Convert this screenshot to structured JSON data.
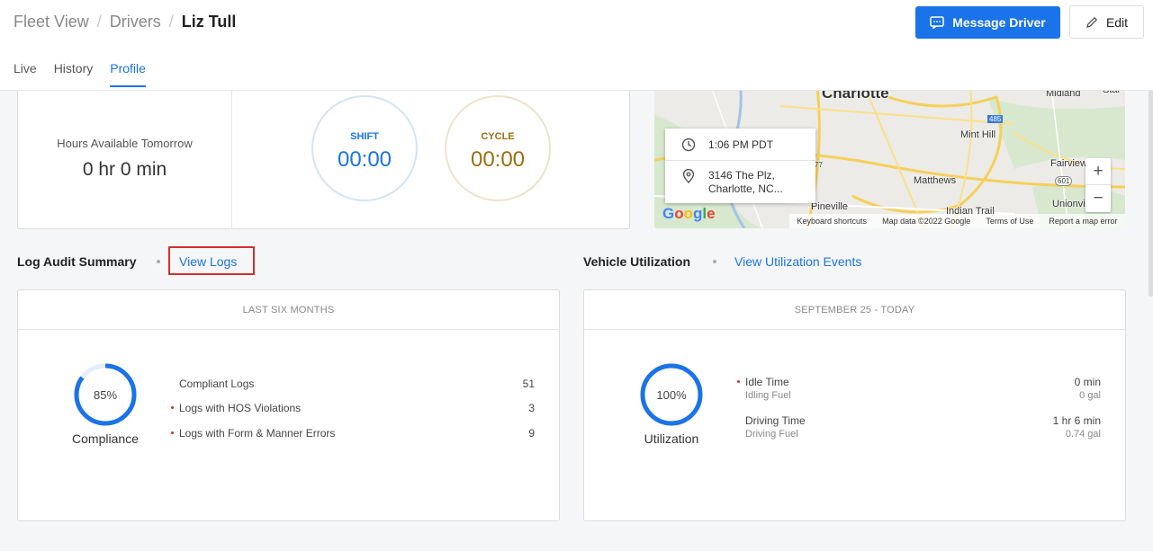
{
  "breadcrumb": {
    "items": [
      "Fleet View",
      "Drivers"
    ],
    "current": "Liz Tull"
  },
  "header": {
    "message_button": "Message Driver",
    "edit_button": "Edit"
  },
  "tabs": [
    {
      "label": "Live",
      "active": false
    },
    {
      "label": "History",
      "active": false
    },
    {
      "label": "Profile",
      "active": true
    }
  ],
  "hours": {
    "label": "Hours Available Tomorrow",
    "value": "0 hr 0 min",
    "shift_label": "SHIFT",
    "shift_value": "00:00",
    "cycle_label": "CYCLE",
    "cycle_value": "00:00"
  },
  "map": {
    "popup_time": "1:06 PM PDT",
    "popup_address_line1": "3146 The Plz,",
    "popup_address_line2": "Charlotte, NC...",
    "places": [
      "Charlotte",
      "Midland",
      "Star",
      "Mint Hill",
      "Fairview",
      "Matthews",
      "Pineville",
      "Indian Trail",
      "Unionvi"
    ],
    "roads": [
      "485",
      "77",
      "601"
    ],
    "google_logo": "Google",
    "footer": [
      "Keyboard shortcuts",
      "Map data ©2022 Google",
      "Terms of Use",
      "Report a map error"
    ],
    "zoom_in": "+",
    "zoom_out": "−"
  },
  "log_audit": {
    "title": "Log Audit Summary",
    "link": "View Logs",
    "period": "LAST SIX MONTHS",
    "percent": 85,
    "percent_label": "85%",
    "caption": "Compliance",
    "rows": [
      {
        "label": "Compliant Logs",
        "value": "51"
      },
      {
        "label": "Logs with HOS Violations",
        "value": "3"
      },
      {
        "label": "Logs with Form & Manner Errors",
        "value": "9"
      }
    ]
  },
  "vehicle_util": {
    "title": "Vehicle Utilization",
    "link": "View Utilization Events",
    "period": "SEPTEMBER 25  -  TODAY",
    "percent": 100,
    "percent_label": "100%",
    "caption": "Utilization",
    "idle_label": "Idle Time",
    "idle_value": "0 min",
    "idle_fuel_label": "Idling Fuel",
    "idle_fuel_value": "0 gal",
    "drive_label": "Driving Time",
    "drive_value": "1 hr 6 min",
    "drive_fuel_label": "Driving Fuel",
    "drive_fuel_value": "0.74 gal"
  },
  "colors": {
    "accent": "#1a73e8",
    "cycle": "#9a6f0f",
    "alert": "#d32f2f",
    "highlight_box": "#d32f2f"
  }
}
